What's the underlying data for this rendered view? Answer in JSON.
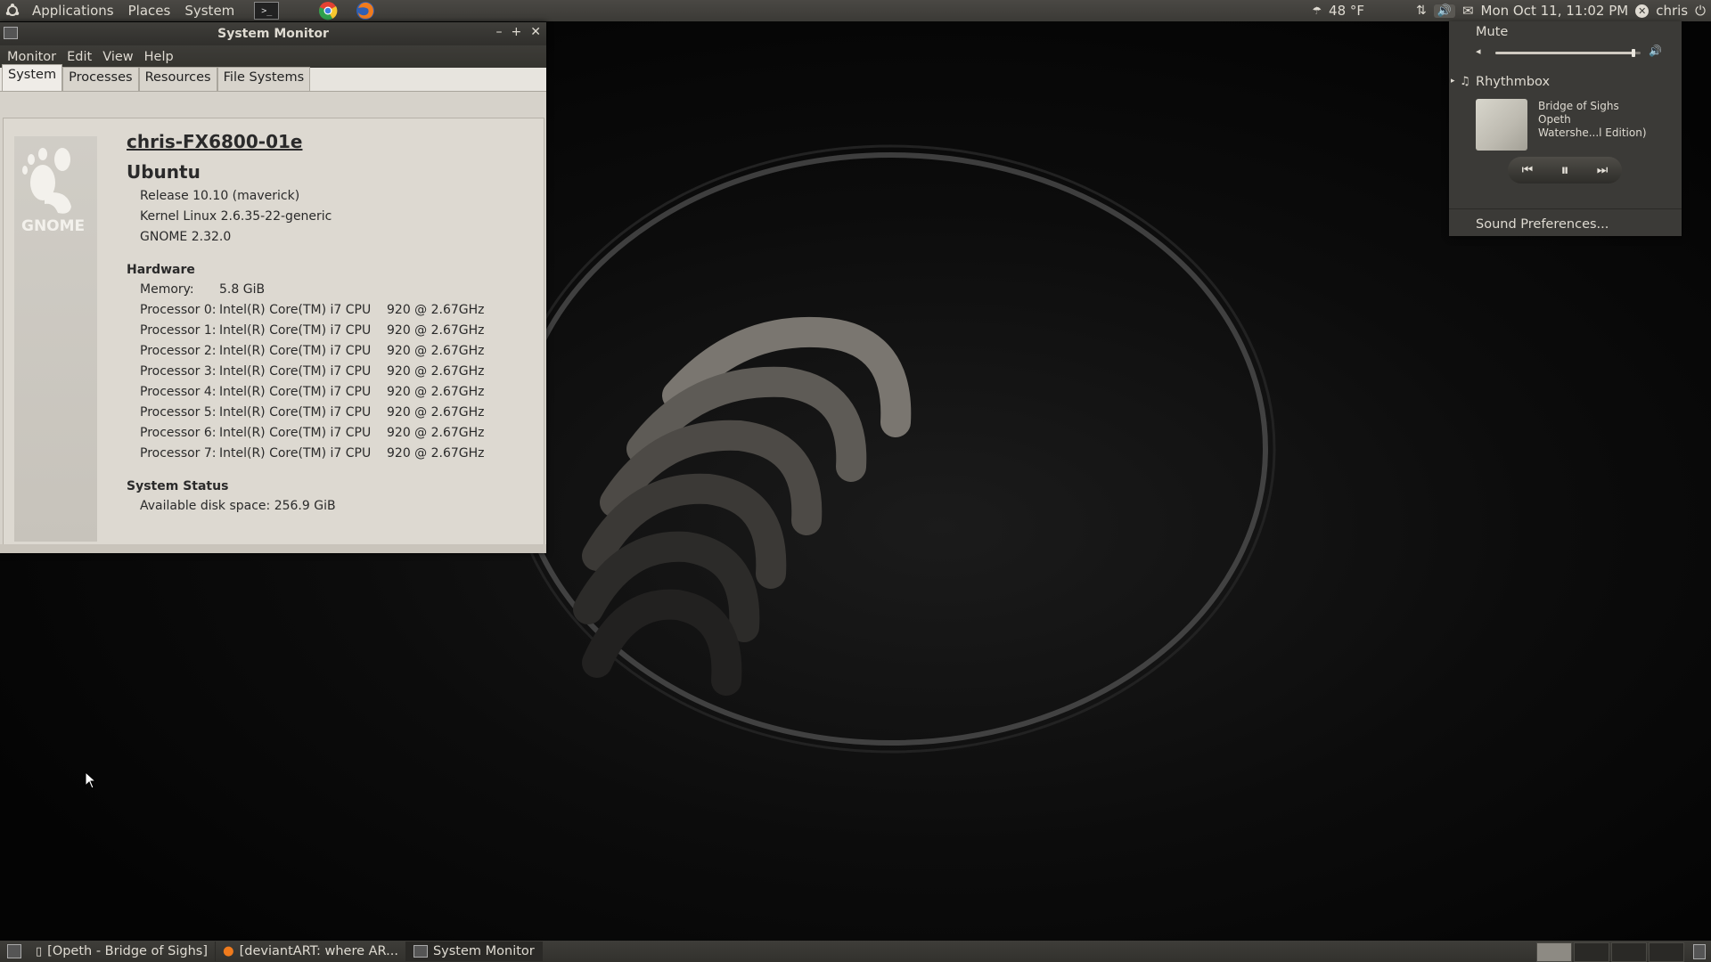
{
  "top_panel": {
    "menus": [
      "Applications",
      "Places",
      "System"
    ],
    "weather": "48 °F",
    "clock": "Mon Oct 11, 11:02 PM",
    "user": "chris"
  },
  "window": {
    "title": "System Monitor",
    "menubar": [
      "Monitor",
      "Edit",
      "View",
      "Help"
    ],
    "tabs": [
      "System",
      "Processes",
      "Resources",
      "File Systems"
    ],
    "active_tab": "System"
  },
  "system": {
    "gnome_logo_text": "GNOME",
    "hostname": "chris-FX6800-01e",
    "os": "Ubuntu",
    "release": "Release 10.10 (maverick)",
    "kernel": "Kernel Linux 2.6.35-22-generic",
    "gnome": "GNOME 2.32.0",
    "hardware_heading": "Hardware",
    "memory_label": "Memory:",
    "memory_value": "5.8 GiB",
    "processors": [
      {
        "label": "Processor 0:",
        "cpu": "Intel(R) Core(TM) i7 CPU",
        "speed": "920 @ 2.67GHz"
      },
      {
        "label": "Processor 1:",
        "cpu": "Intel(R) Core(TM) i7 CPU",
        "speed": "920 @ 2.67GHz"
      },
      {
        "label": "Processor 2:",
        "cpu": "Intel(R) Core(TM) i7 CPU",
        "speed": "920 @ 2.67GHz"
      },
      {
        "label": "Processor 3:",
        "cpu": "Intel(R) Core(TM) i7 CPU",
        "speed": "920 @ 2.67GHz"
      },
      {
        "label": "Processor 4:",
        "cpu": "Intel(R) Core(TM) i7 CPU",
        "speed": "920 @ 2.67GHz"
      },
      {
        "label": "Processor 5:",
        "cpu": "Intel(R) Core(TM) i7 CPU",
        "speed": "920 @ 2.67GHz"
      },
      {
        "label": "Processor 6:",
        "cpu": "Intel(R) Core(TM) i7 CPU",
        "speed": "920 @ 2.67GHz"
      },
      {
        "label": "Processor 7:",
        "cpu": "Intel(R) Core(TM) i7 CPU",
        "speed": "920 @ 2.67GHz"
      }
    ],
    "status_heading": "System Status",
    "disk_label": "Available disk space:",
    "disk_value": "256.9 GiB"
  },
  "sound_menu": {
    "mute_label": "Mute",
    "volume_level": 0.95,
    "player": "Rhythmbox",
    "track": "Bridge of Sighs",
    "artist": "Opeth",
    "album": "Watershe...l Edition)",
    "prev_icon": "previous-track-icon",
    "pause_icon": "pause-icon",
    "next_icon": "next-track-icon",
    "preferences": "Sound Preferences..."
  },
  "bottom_panel": {
    "tasks": [
      {
        "label": "[Opeth - Bridge of Sighs]",
        "icon": "music-player-icon"
      },
      {
        "label": "[deviantART: where AR...",
        "icon": "firefox-icon"
      },
      {
        "label": "System Monitor",
        "icon": "system-monitor-icon"
      }
    ]
  }
}
